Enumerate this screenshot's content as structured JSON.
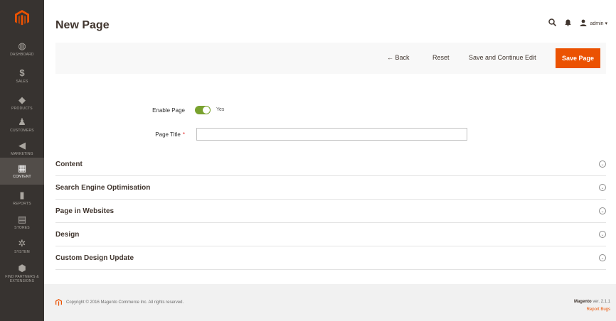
{
  "sidebar": {
    "items": [
      {
        "label": "DASHBOARD",
        "icon": "dashboard-icon",
        "glyph": "◍"
      },
      {
        "label": "SALES",
        "icon": "dollar-icon",
        "glyph": "$"
      },
      {
        "label": "PRODUCTS",
        "icon": "cube-icon",
        "glyph": "◆"
      },
      {
        "label": "CUSTOMERS",
        "icon": "person-icon",
        "glyph": "♟"
      },
      {
        "label": "MARKETING",
        "icon": "megaphone-icon",
        "glyph": "◀"
      },
      {
        "label": "CONTENT",
        "icon": "layout-icon",
        "glyph": "▦"
      },
      {
        "label": "REPORTS",
        "icon": "bar-chart-icon",
        "glyph": "▮"
      },
      {
        "label": "STORES",
        "icon": "store-icon",
        "glyph": "▤"
      },
      {
        "label": "SYSTEM",
        "icon": "gear-icon",
        "glyph": "✲"
      },
      {
        "label": "FIND PARTNERS & EXTENSIONS",
        "icon": "puzzle-icon",
        "glyph": "⬢"
      }
    ],
    "active_index": 5
  },
  "header": {
    "title": "New Page",
    "user": "admin ▾"
  },
  "toolbar": {
    "back_label": "← Back",
    "reset_label": "Reset",
    "save_continue_label": "Save and Continue Edit",
    "save_label": "Save Page"
  },
  "form": {
    "enable_label": "Enable Page",
    "enable_value": "Yes",
    "title_label": "Page Title",
    "title_required_mark": "*",
    "title_value": ""
  },
  "sections": [
    {
      "title": "Content"
    },
    {
      "title": "Search Engine Optimisation"
    },
    {
      "title": "Page in Websites"
    },
    {
      "title": "Design"
    },
    {
      "title": "Custom Design Update"
    }
  ],
  "footer": {
    "copyright": "Copyright © 2016 Magento Commerce Inc. All rights reserved.",
    "brand": "Magento",
    "version": "ver. 2.1.1",
    "report_bugs": "Report Bugs"
  },
  "colors": {
    "accent": "#eb5202",
    "toggle_on": "#79a22e",
    "sidebar_bg": "#373330"
  }
}
